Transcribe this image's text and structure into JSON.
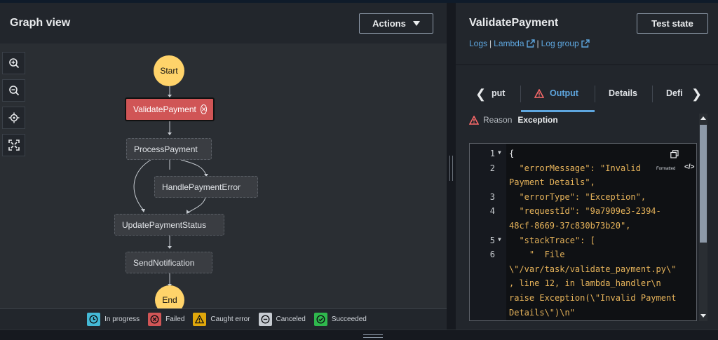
{
  "graph": {
    "title": "Graph view",
    "actions_label": "Actions",
    "nodes": {
      "start": "Start",
      "validate": "ValidatePayment",
      "process": "ProcessPayment",
      "handle_error": "HandlePaymentError",
      "update_status": "UpdatePaymentStatus",
      "send_notification": "SendNotification",
      "end": "End"
    },
    "legend": [
      {
        "label": "In progress",
        "color": "#44b9d6"
      },
      {
        "label": "Failed",
        "color": "#d05556"
      },
      {
        "label": "Caught error",
        "color": "#e0a70b"
      },
      {
        "label": "Canceled",
        "color": "#c6cbd1"
      },
      {
        "label": "Succeeded",
        "color": "#2fb84d"
      }
    ]
  },
  "detail": {
    "title": "ValidatePayment",
    "test_label": "Test state",
    "links": {
      "logs": "Logs",
      "lambda": "Lambda",
      "log_group": "Log group",
      "sep": "|"
    },
    "tabs": {
      "input": "put",
      "output": "Output",
      "details": "Details",
      "definition": "Defi"
    },
    "reason_label": "Reason",
    "reason_value": "Exception",
    "formatted_label": "Formatted",
    "code_lines": [
      {
        "num": "1",
        "text": "{"
      },
      {
        "num": "2",
        "text": "  \"errorMessage\": \"Invalid"
      },
      {
        "num": "",
        "text": "Payment Details\","
      },
      {
        "num": "3",
        "text": "  \"errorType\": \"Exception\","
      },
      {
        "num": "4",
        "text": "  \"requestId\": \"9a7909e3-2394-"
      },
      {
        "num": "",
        "text": "48cf-8669-37c830b73b20\","
      },
      {
        "num": "5",
        "text": "  \"stackTrace\": ["
      },
      {
        "num": "6",
        "text": "    \"  File"
      },
      {
        "num": "",
        "text": "\\\"/var/task/validate_payment.py\\\""
      },
      {
        "num": "",
        "text": ", line 12, in lambda_handler\\n"
      },
      {
        "num": "",
        "text": "raise Exception(\\\"Invalid Payment"
      },
      {
        "num": "",
        "text": "Details\\\")\\n\""
      }
    ]
  },
  "colors": {
    "accent": "#5ea6df",
    "failed": "#d05556",
    "state_circle": "#ffd36a",
    "code_string": "#e6b35a"
  }
}
